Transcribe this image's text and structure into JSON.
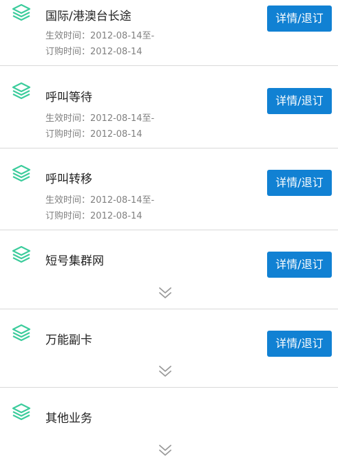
{
  "colors": {
    "accent": "#1181d3",
    "icon": "#3ccc9c",
    "chevron": "#9a9a9a"
  },
  "labels": {
    "detail_unsubscribe": "详情/退订",
    "effective_prefix": "生效时间：",
    "order_prefix": "订购时间："
  },
  "services": [
    {
      "name": "国际/港澳台长途",
      "effective": "生效时间：2012-08-14至-",
      "ordered": "订购时间：2012-08-14",
      "icon": "layers-icon"
    },
    {
      "name": "呼叫等待",
      "effective": "生效时间：2012-08-14至-",
      "ordered": "订购时间：2012-08-14",
      "icon": "layers-icon"
    },
    {
      "name": "呼叫转移",
      "effective": "生效时间：2012-08-14至-",
      "ordered": "订购时间：2012-08-14",
      "icon": "layers-icon"
    },
    {
      "name": "短号集群网",
      "icon": "layers-icon",
      "expand_icon": "double-chevron-down-icon"
    },
    {
      "name": "万能副卡",
      "icon": "layers-icon",
      "expand_icon": "double-chevron-down-icon"
    },
    {
      "name": "其他业务",
      "icon": "layers-icon",
      "expand_icon": "double-chevron-down-icon"
    }
  ]
}
